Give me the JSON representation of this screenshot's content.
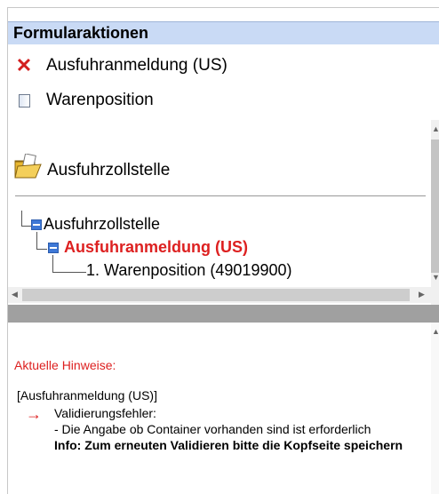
{
  "header": {
    "title": "Formularaktionen"
  },
  "actions": [
    {
      "label": "Ausfuhranmeldung (US)",
      "icon": "delete-x-icon"
    },
    {
      "label": "Warenposition",
      "icon": "document-icon"
    }
  ],
  "tree": {
    "section_title": "Ausfuhrzollstelle",
    "nodes": [
      {
        "label": "Ausfuhrzollstelle"
      },
      {
        "label": "Ausfuhranmeldung (US)"
      },
      {
        "label": "1. Warenposition (49019900)"
      }
    ]
  },
  "hints": {
    "heading": "Aktuelle Hinweise:",
    "context": "[Ausfuhranmeldung (US)]",
    "error_title": "Validierungsfehler:",
    "error_detail": "- Die Angabe ob Container vorhanden sind ist erforderlich",
    "info": "Info: Zum erneuten Validieren bitte die Kopfseite speichern"
  },
  "colors": {
    "header_bg": "#c9daf5",
    "error_red": "#dd2020",
    "tree_node_blue": "#3e78d6"
  }
}
